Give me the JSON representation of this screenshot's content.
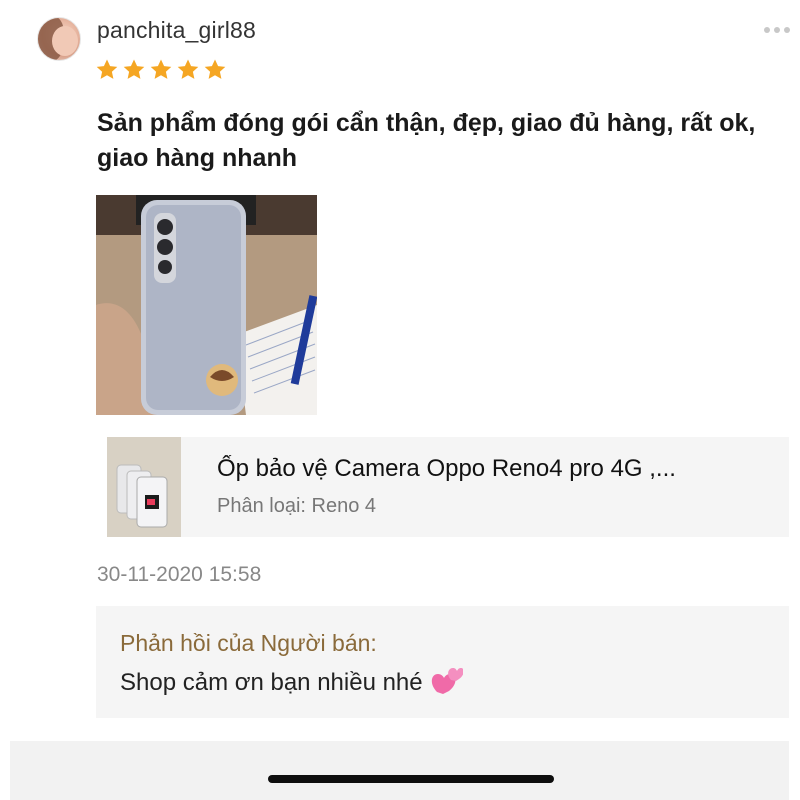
{
  "review": {
    "username": "panchita_girl88",
    "rating": 5,
    "text": "Sản phẩm đóng gói cẩn thận, đẹp, giao đủ hàng, rất ok, giao hàng nhanh",
    "date": "30-11-2020 15:58"
  },
  "product": {
    "name": "Ốp bảo vệ Camera Oppo Reno4 pro 4G ,...",
    "variant": "Phân loại: Reno 4"
  },
  "seller_reply": {
    "label": "Phản hồi của Người bán:",
    "text": "Shop cảm ơn bạn nhiều nhé"
  },
  "icons": {
    "more": "more-dots-icon",
    "star": "star-icon",
    "heart": "two-hearts-emoji"
  },
  "colors": {
    "star": "#f5a623",
    "seller_label": "#8a6a3a",
    "card_bg": "#f5f5f5"
  }
}
